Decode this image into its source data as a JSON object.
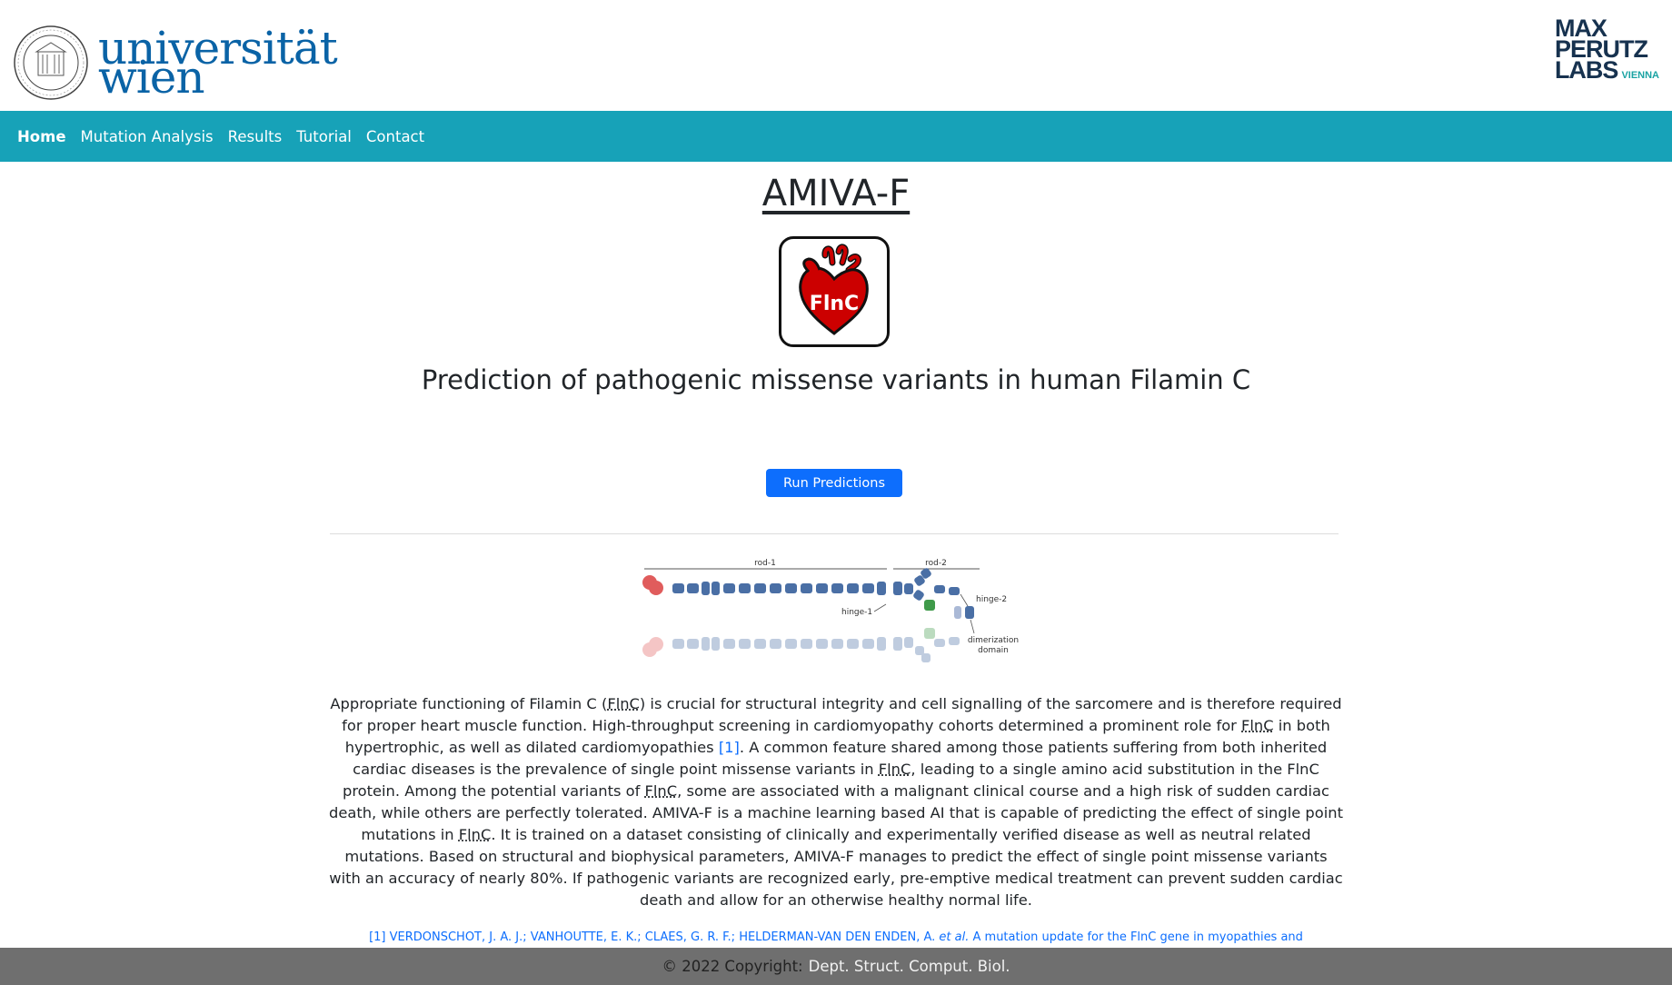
{
  "header": {
    "university_logo": {
      "line1": "universität",
      "line2": "wien",
      "seal_icon": "university-seal-icon"
    },
    "institute_logo": {
      "line1": "MAX",
      "line2": "PERUTZ",
      "line3": "LABS",
      "tag": "VIENNA"
    }
  },
  "nav": {
    "items": [
      {
        "label": "Home",
        "active": true
      },
      {
        "label": "Mutation Analysis",
        "active": false
      },
      {
        "label": "Results",
        "active": false
      },
      {
        "label": "Tutorial",
        "active": false
      },
      {
        "label": "Contact",
        "active": false
      }
    ]
  },
  "main": {
    "title": "AMIVA-F",
    "logo_text": "FlnC",
    "subtitle": "Prediction of pathogenic missense variants in human Filamin C",
    "run_button": "Run Predictions",
    "diagram": {
      "rod1": "rod-1",
      "rod2": "rod-2",
      "hinge1": "hinge-1",
      "hinge2": "hinge-2",
      "dimer1": "dimerization",
      "dimer2": "domain"
    },
    "paragraph": {
      "p1": "Appropriate functioning of Filamin C (",
      "abbr": "FlnC",
      "p2": ") is crucial for structural integrity and cell signalling of the sarcomere and is therefore required for proper heart muscle function. High-throughput screening in cardiomyopathy cohorts determined a prominent role for ",
      "p3": " in both hypertrophic, as well as dilated cardiomyopathies ",
      "cite": "[1]",
      "p4": ". A common feature shared among those patients suffering from both inherited cardiac diseases is the prevalence of single point missense variants in ",
      "p5": ", leading to a single amino acid substitution in the FlnC protein. Among the potential variants of ",
      "p6": ", some are associated with a malignant clinical course and a high risk of sudden cardiac death, while others are perfectly tolerated. AMIVA-F is a machine learning based AI that is capable of predicting the effect of single point mutations in ",
      "p7": ". It is trained on a dataset consisting of clinically and experimentally verified disease as well as neutral related mutations. Based on structural and biophysical parameters, AMIVA-F manages to predict the effect of single point missense variants with an accuracy of nearly 80%. If pathogenic variants are recognized early, pre-emptive medical treatment can prevent sudden cardiac death and allow for an otherwise healthy normal life."
    },
    "reference": {
      "before": "[1] VERDONSCHOT, J. A. J.; VANHOUTTE, E. K.; CLAES, G. R. F.; HELDERMAN-VAN DEN ENDEN, A. ",
      "etal": "et al.",
      "after": " A mutation update for the FlnC gene in myopathies and"
    }
  },
  "footer": {
    "copyright": "© 2022 Copyright:",
    "org": "Dept. Struct. Comput. Biol."
  },
  "colors": {
    "nav_bg": "#17a2b8",
    "button": "#0d6efd",
    "footer_bg": "#6f6f6f",
    "uni_blue": "#0a63a6",
    "heart_red": "#cc0000"
  }
}
